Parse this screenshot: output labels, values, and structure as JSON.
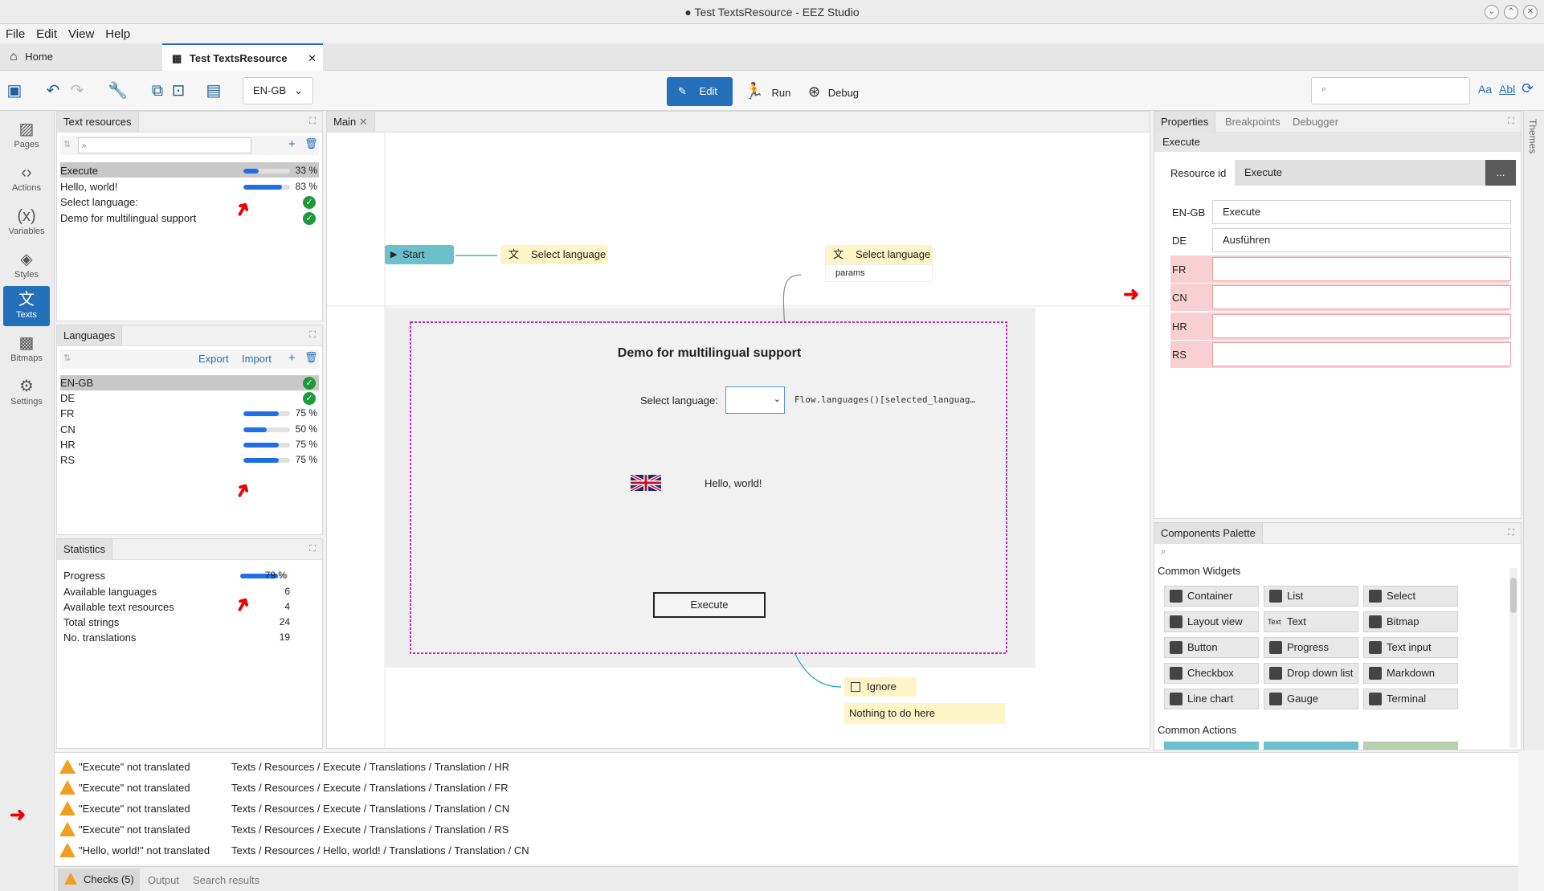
{
  "window": {
    "title": "● Test TextsResource - EEZ Studio"
  },
  "menu": [
    "File",
    "Edit",
    "View",
    "Help"
  ],
  "tabs": {
    "home": "Home",
    "doc": "Test TextsResource"
  },
  "toolbar": {
    "language": "EN-GB",
    "edit": "Edit",
    "run": "Run",
    "debug": "Debug",
    "match_case": "Aa",
    "whole_word": "Abl"
  },
  "nav": [
    {
      "label": "Pages",
      "icon": "pages-icon"
    },
    {
      "label": "Actions",
      "icon": "actions-icon"
    },
    {
      "label": "Variables",
      "icon": "variables-icon"
    },
    {
      "label": "Styles",
      "icon": "styles-icon"
    },
    {
      "label": "Texts",
      "icon": "texts-icon"
    },
    {
      "label": "Bitmaps",
      "icon": "bitmaps-icon"
    },
    {
      "label": "Settings",
      "icon": "settings-icon"
    }
  ],
  "text_resources": {
    "title": "Text resources",
    "items": [
      {
        "name": "Execute",
        "progress": 33,
        "pct": "33 %"
      },
      {
        "name": "Hello, world!",
        "progress": 83,
        "pct": "83 %"
      },
      {
        "name": "Select language:",
        "progress": 100,
        "pct": ""
      },
      {
        "name": "Demo for multilingual support",
        "progress": 100,
        "pct": ""
      }
    ]
  },
  "languages": {
    "title": "Languages",
    "export": "Export",
    "import": "Import",
    "items": [
      {
        "name": "EN-GB",
        "progress": 100,
        "pct": ""
      },
      {
        "name": "DE",
        "progress": 100,
        "pct": ""
      },
      {
        "name": "FR",
        "progress": 75,
        "pct": "75 %"
      },
      {
        "name": "CN",
        "progress": 50,
        "pct": "50 %"
      },
      {
        "name": "HR",
        "progress": 75,
        "pct": "75 %"
      },
      {
        "name": "RS",
        "progress": 75,
        "pct": "75 %"
      }
    ]
  },
  "statistics": {
    "title": "Statistics",
    "progress_label": "Progress",
    "progress": 79,
    "progress_pct": "79 %",
    "rows": [
      {
        "label": "Available languages",
        "value": "6"
      },
      {
        "label": "Available text resources",
        "value": "4"
      },
      {
        "label": "Total strings",
        "value": "24"
      },
      {
        "label": "No. translations",
        "value": "19"
      }
    ]
  },
  "editor": {
    "tab": "Main",
    "start": "Start",
    "select_language_1": "Select language",
    "select_language_2": "Select language",
    "params": "params",
    "page_title": "Demo for multilingual support",
    "select_label": "Select language:",
    "expr": "Flow.languages()[selected_languag…",
    "hello": "Hello, world!",
    "execute": "Execute",
    "ignore": "Ignore",
    "comment": "Nothing to do here"
  },
  "properties": {
    "tabs": [
      "Properties",
      "Breakpoints",
      "Debugger"
    ],
    "header": "Execute",
    "resource_id_label": "Resource id",
    "resource_id": "Execute",
    "more": "...",
    "translations": [
      {
        "lang": "EN-GB",
        "value": "Execute",
        "missing": false
      },
      {
        "lang": "DE",
        "value": "Ausführen",
        "missing": false
      },
      {
        "lang": "FR",
        "value": "",
        "missing": true
      },
      {
        "lang": "CN",
        "value": "",
        "missing": true
      },
      {
        "lang": "HR",
        "value": "",
        "missing": true
      },
      {
        "lang": "RS",
        "value": "",
        "missing": true
      }
    ]
  },
  "themes": "Themes",
  "palette": {
    "title": "Components Palette",
    "common_widgets": "Common Widgets",
    "widgets": [
      "Container",
      "List",
      "Select",
      "Layout view",
      "Text",
      "Bitmap",
      "Button",
      "Progress",
      "Text input",
      "Checkbox",
      "Drop down list",
      "Markdown",
      "Line chart",
      "Gauge",
      "Terminal"
    ],
    "text_icon": "Text",
    "common_actions": "Common Actions"
  },
  "checks": [
    {
      "msg": "\"Execute\" not translated",
      "path": "Texts / Resources / Execute / Translations / Translation / HR"
    },
    {
      "msg": "\"Execute\" not translated",
      "path": "Texts / Resources / Execute / Translations / Translation / FR"
    },
    {
      "msg": "\"Execute\" not translated",
      "path": "Texts / Resources / Execute / Translations / Translation / CN"
    },
    {
      "msg": "\"Execute\" not translated",
      "path": "Texts / Resources / Execute / Translations / Translation / RS"
    },
    {
      "msg": "\"Hello, world!\" not translated",
      "path": "Texts / Resources / Hello, world! / Translations / Translation / CN"
    }
  ],
  "bottom_tabs": {
    "checks": "Checks (5)",
    "output": "Output",
    "search": "Search results"
  },
  "colors": {
    "accent": "#2470b8",
    "progress": "#1d6fe3",
    "ok": "#1e9a3a",
    "missing": "#f8d0d4",
    "warning": "#f0a020"
  }
}
